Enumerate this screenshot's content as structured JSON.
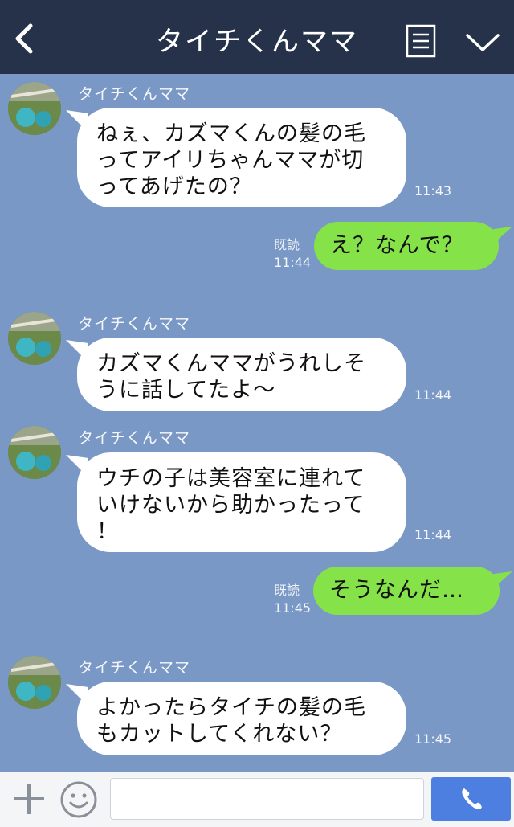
{
  "header": {
    "title": "タイチくんママ",
    "back_icon": "chevron-left-icon",
    "menu_icon": "menu-lines-icon",
    "collapse_icon": "chevron-down-icon",
    "background": "#25324a"
  },
  "chat": {
    "background": "#7a98c5",
    "messages": [
      {
        "sender": "タイチくんママ",
        "lines": [
          "ねぇ、カズマくんの髪の毛",
          "ってアイリちゃんママが切",
          "ってあげたの？"
        ],
        "time": "11:43"
      },
      {
        "read": "既読",
        "time": "11:44",
        "lines": [
          "え？なんで？"
        ]
      },
      {
        "sender": "タイチくんママ",
        "lines": [
          "カズマくんママがうれしそ",
          "うに話してたよ〜"
        ],
        "time": "11:44"
      },
      {
        "sender": "タイチくんママ",
        "lines": [
          "ウチの子は美容室に連れて",
          "いけないから助かったって",
          "！"
        ],
        "time": "11:44"
      },
      {
        "read": "既読",
        "time": "11:45",
        "lines": [
          "そうなんだ…"
        ]
      },
      {
        "sender": "タイチくんママ",
        "lines": [
          "よかったらタイチの髪の毛",
          "もカットしてくれない？"
        ],
        "time": "11:45"
      }
    ],
    "incoming_color": "#ffffff",
    "outgoing_color": "#85e249"
  },
  "inputbar": {
    "plus_icon": "plus-icon",
    "emoji_icon": "smiley-icon",
    "input_value": "",
    "call_icon": "phone-icon",
    "call_color": "#4d7fe0"
  }
}
